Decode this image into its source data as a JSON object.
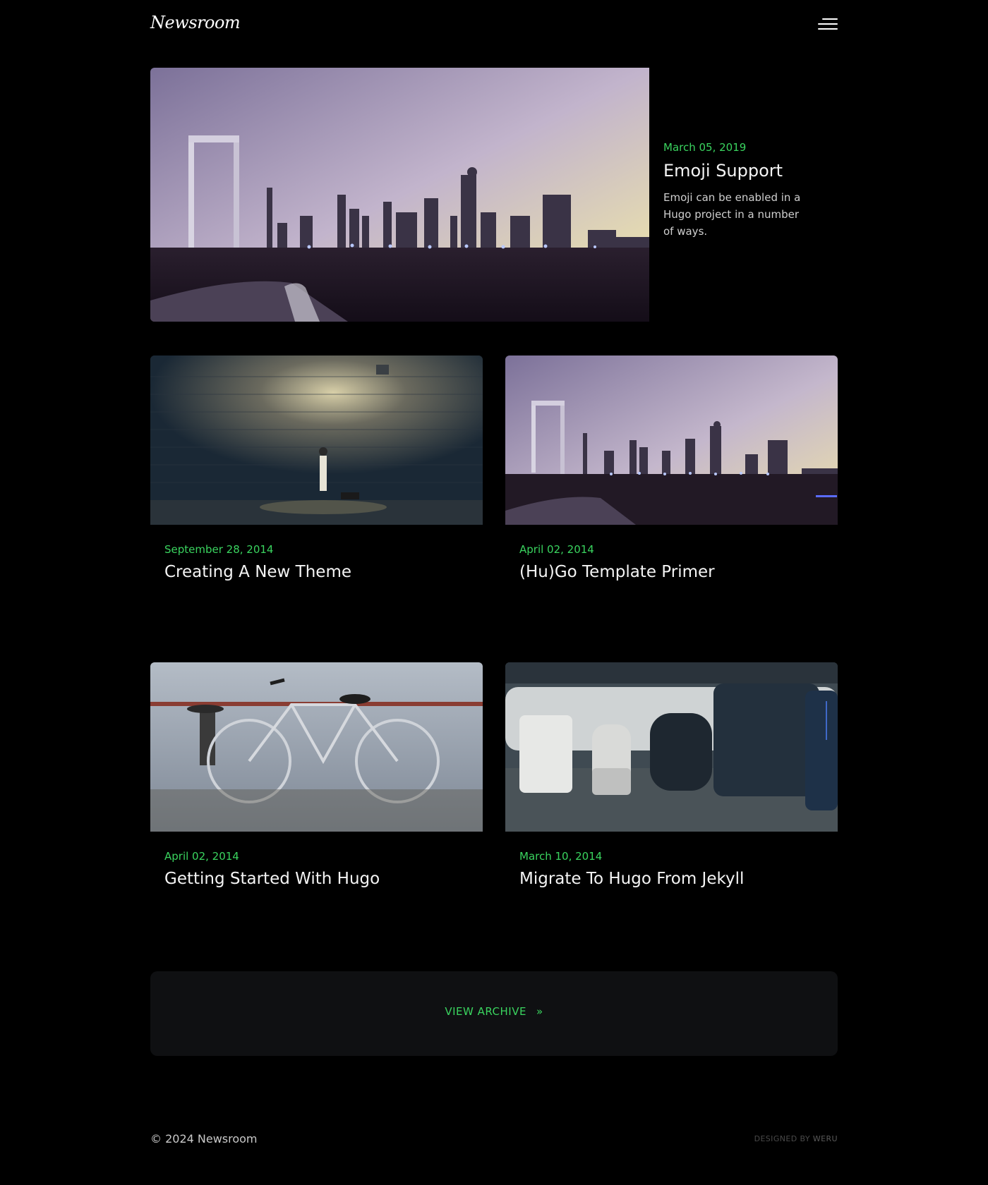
{
  "header": {
    "logo": "Newsroom",
    "menu_icon": "hamburger-menu-icon"
  },
  "featured": {
    "date": "March 05, 2019",
    "title": "Emoji Support",
    "excerpt": "Emoji can be enabled in a Hugo project in a number of ways."
  },
  "posts": [
    {
      "date": "September 28, 2014",
      "title": "Creating A New Theme"
    },
    {
      "date": "April 02, 2014",
      "title": "(Hu)Go Template Primer"
    },
    {
      "date": "April 02, 2014",
      "title": "Getting Started With Hugo"
    },
    {
      "date": "March 10, 2014",
      "title": "Migrate To Hugo From Jekyll"
    }
  ],
  "archive": {
    "label": "VIEW ARCHIVE",
    "arrow": "»"
  },
  "footer": {
    "copyright": "© 2024 Newsroom",
    "designed_by": "DESIGNED BY",
    "credit": "WERU"
  },
  "colors": {
    "background": "#000000",
    "accent": "#3ad45f",
    "panel": "#0f1012"
  }
}
